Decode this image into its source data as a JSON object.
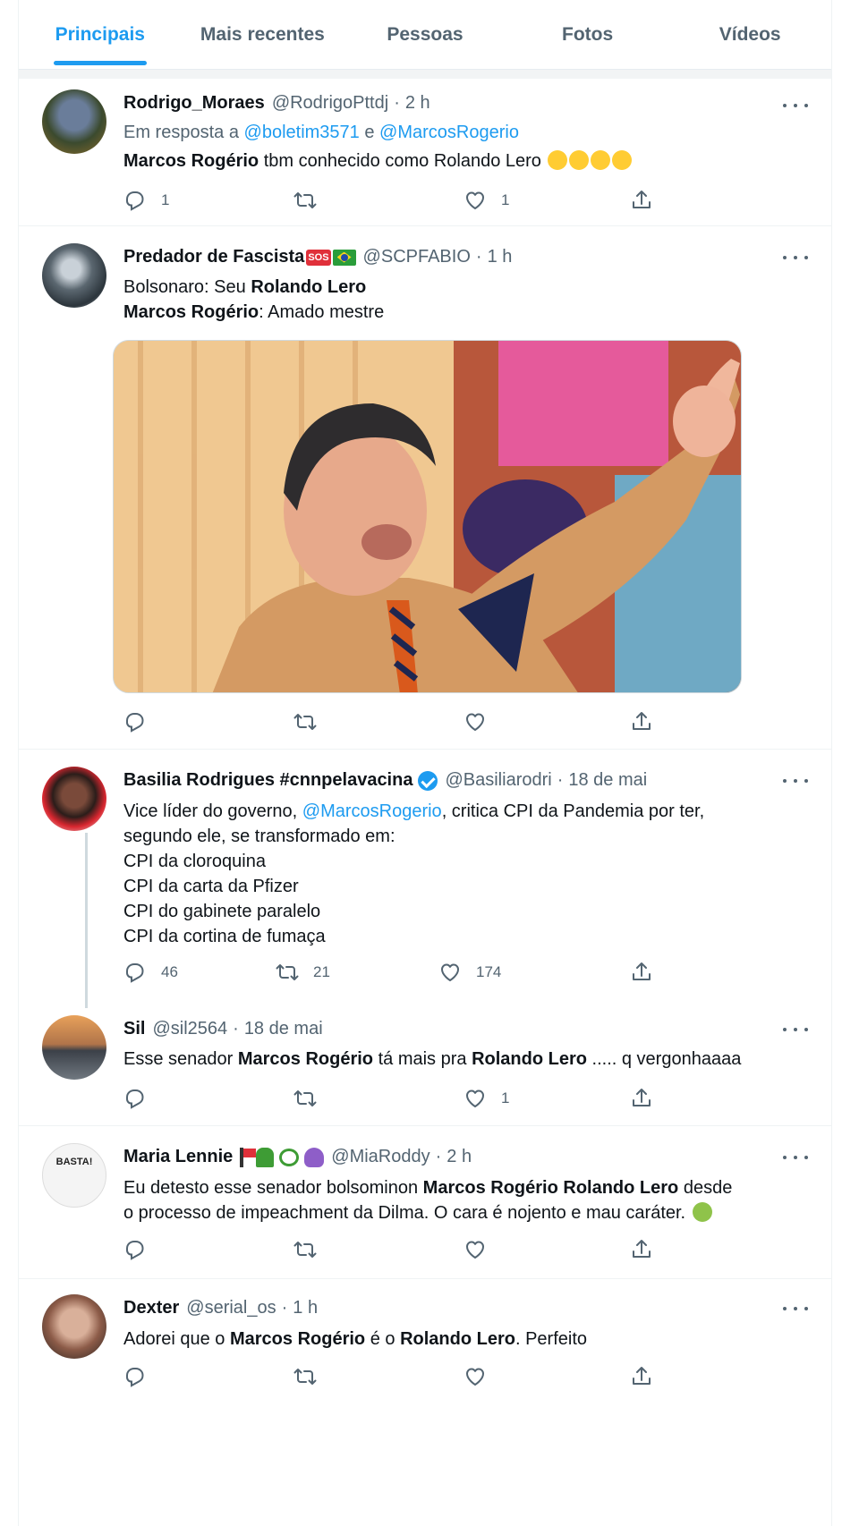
{
  "tabs": [
    {
      "label": "Principais",
      "active": true
    },
    {
      "label": "Mais recentes",
      "active": false
    },
    {
      "label": "Pessoas",
      "active": false
    },
    {
      "label": "Fotos",
      "active": false
    },
    {
      "label": "Vídeos",
      "active": false
    }
  ],
  "tweets": [
    {
      "name": "Rodrigo_Moraes",
      "handle": "@RodrigoPttdj",
      "time": "2 h",
      "reply_prefix": "Em resposta a",
      "reply_user1": "@boletim3571",
      "reply_and": "e",
      "reply_user2": "@MarcosRogerio",
      "text_bold": "Marcos Rogério",
      "text_rest": "tbm conhecido como Rolando Lero",
      "replies": "1",
      "retweets": "",
      "likes": "1"
    },
    {
      "name": "Predador de Fascista",
      "badge": "SOS",
      "handle": "@SCPFABIO",
      "time": "1 h",
      "l1_a": "Bolsonaro: Seu",
      "l1_b": "Rolando Lero",
      "l2_a": "Marcos Rogério",
      "l2_b": ": Amado mestre",
      "replies": "",
      "retweets": "",
      "likes": ""
    },
    {
      "name": "Basilia Rodrigues #cnnpelavacina",
      "handle": "@Basiliarodri",
      "time": "18 de mai",
      "l1_a": "Vice líder do governo,",
      "l1_link": "@MarcosRogerio",
      "l1_b": ", critica CPI da Pandemia por ter,",
      "l2": "segundo ele, se transformado em:",
      "l3": "CPI da cloroquina",
      "l4": "CPI da carta da Pfizer",
      "l5": "CPI do gabinete paralelo",
      "l6": "CPI da cortina de fumaça",
      "replies": "46",
      "retweets": "21",
      "likes": "174"
    },
    {
      "name": "Sil",
      "handle": "@sil2564",
      "time": "18 de mai",
      "t_a": "Esse senador",
      "t_b": "Marcos Rogério",
      "t_c": "tá mais pra",
      "t_d": "Rolando Lero",
      "t_e": "..... q vergonhaaaa",
      "replies": "",
      "retweets": "",
      "likes": "1"
    },
    {
      "name": "Maria Lennie",
      "handle": "@MiaRoddy",
      "time": "2 h",
      "avatar_text": "BASTA!",
      "l1_a": "Eu detesto esse senador bolsominon ",
      "l1_b": "Marcos Rogério Rolando Lero",
      "l1_c": "desde",
      "l2": "o processo de impeachment da Dilma. O cara é nojento e mau caráter.",
      "replies": "",
      "retweets": "",
      "likes": ""
    },
    {
      "name": "Dexter",
      "handle": "@serial_os",
      "time": "1 h",
      "t_a": "Adorei que o",
      "t_b": "Marcos Rogério",
      "t_c": "é o",
      "t_d": "Rolando Lero",
      "t_e": ". Perfeito",
      "replies": "",
      "retweets": "",
      "likes": ""
    }
  ],
  "colors": {
    "accent": "#1d9bf0",
    "text": "#0f1419",
    "muted": "#536471"
  }
}
